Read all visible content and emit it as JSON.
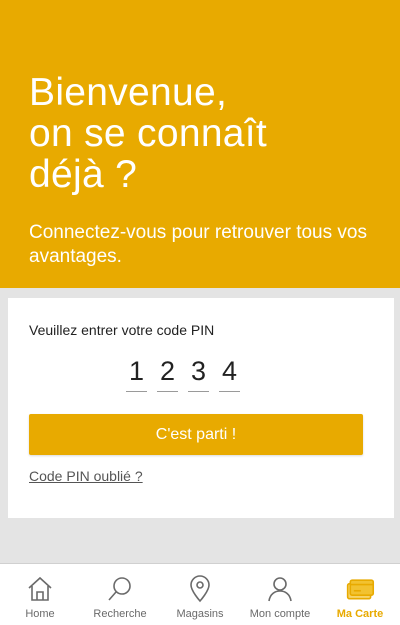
{
  "hero": {
    "title_lines": [
      "Bienvenue,",
      "on se connaît",
      "déjà ?"
    ],
    "subtitle": "Connectez-vous pour retrouver tous vos avantages."
  },
  "pin": {
    "label": "Veuillez entrer votre code PIN",
    "digits": [
      "1",
      "2",
      "3",
      "4"
    ],
    "submit_label": "C'est parti !",
    "forgot_label": "Code PIN oublié ?"
  },
  "tabs": [
    {
      "label": "Home",
      "icon": "home-icon"
    },
    {
      "label": "Recherche",
      "icon": "search-icon"
    },
    {
      "label": "Magasins",
      "icon": "map-pin-icon"
    },
    {
      "label": "Mon compte",
      "icon": "user-icon"
    },
    {
      "label": "Ma Carte",
      "icon": "card-icon",
      "active": true
    }
  ],
  "colors": {
    "accent": "#e8aa00",
    "background": "#e4e4e4"
  }
}
